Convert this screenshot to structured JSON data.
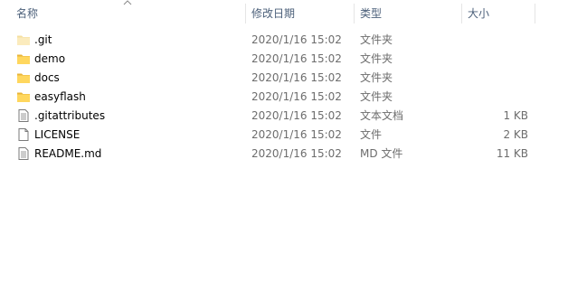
{
  "columns": {
    "name": "名称",
    "modified": "修改日期",
    "type": "类型",
    "size": "大小"
  },
  "sort": {
    "column": "name",
    "direction": "ascending",
    "icon": "sort-up-arrow"
  },
  "colors": {
    "header_text": "#4c607a",
    "detail_text": "#6d6d6d",
    "folder_fill": "#ffd75e",
    "folder_tab": "#e8b53a"
  },
  "files": [
    {
      "name": ".git",
      "modified": "2020/1/16 15:02",
      "type": "文件夹",
      "size": "",
      "icon": "folder-light-icon"
    },
    {
      "name": "demo",
      "modified": "2020/1/16 15:02",
      "type": "文件夹",
      "size": "",
      "icon": "folder-icon"
    },
    {
      "name": "docs",
      "modified": "2020/1/16 15:02",
      "type": "文件夹",
      "size": "",
      "icon": "folder-icon"
    },
    {
      "name": "easyflash",
      "modified": "2020/1/16 15:02",
      "type": "文件夹",
      "size": "",
      "icon": "folder-icon"
    },
    {
      "name": ".gitattributes",
      "modified": "2020/1/16 15:02",
      "type": "文本文档",
      "size": "1 KB",
      "icon": "text-document-icon"
    },
    {
      "name": "LICENSE",
      "modified": "2020/1/16 15:02",
      "type": "文件",
      "size": "2 KB",
      "icon": "blank-file-icon"
    },
    {
      "name": "README.md",
      "modified": "2020/1/16 15:02",
      "type": "MD 文件",
      "size": "11 KB",
      "icon": "text-document-icon"
    }
  ]
}
